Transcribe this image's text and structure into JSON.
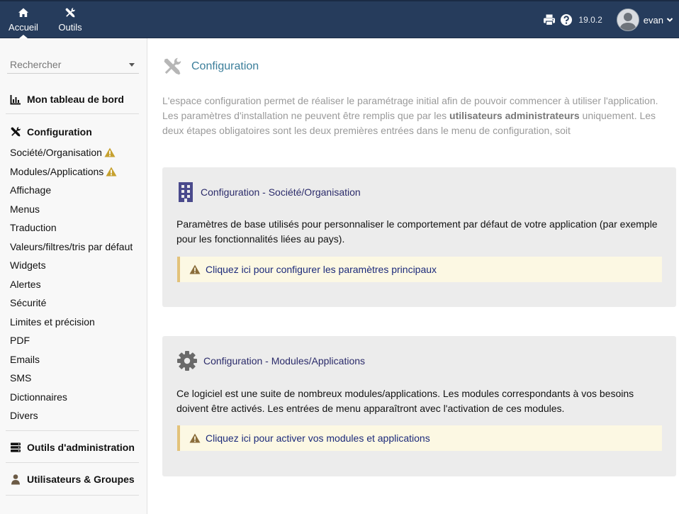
{
  "topbar": {
    "menu": [
      {
        "label": "Accueil",
        "icon": "home-icon",
        "active": true
      },
      {
        "label": "Outils",
        "icon": "tools-icon",
        "active": false
      }
    ],
    "version": "19.0.2",
    "username": "evan"
  },
  "sidebar": {
    "search_placeholder": "Rechercher",
    "dashboard_title": "Mon tableau de bord",
    "config_title": "Configuration",
    "config_items": [
      {
        "label": "Société/Organisation",
        "warning": true
      },
      {
        "label": "Modules/Applications",
        "warning": true
      },
      {
        "label": "Affichage",
        "warning": false
      },
      {
        "label": "Menus",
        "warning": false
      },
      {
        "label": "Traduction",
        "warning": false
      },
      {
        "label": "Valeurs/filtres/tris par défaut",
        "warning": false
      },
      {
        "label": "Widgets",
        "warning": false
      },
      {
        "label": "Alertes",
        "warning": false
      },
      {
        "label": "Sécurité",
        "warning": false
      },
      {
        "label": "Limites et précision",
        "warning": false
      },
      {
        "label": "PDF",
        "warning": false
      },
      {
        "label": "Emails",
        "warning": false
      },
      {
        "label": "SMS",
        "warning": false
      },
      {
        "label": "Dictionnaires",
        "warning": false
      },
      {
        "label": "Divers",
        "warning": false
      }
    ],
    "admin_tools_title": "Outils d'administration",
    "users_groups_title": "Utilisateurs & Groupes"
  },
  "main": {
    "title": "Configuration",
    "intro_part1": "L'espace configuration permet de réaliser le paramétrage initial afin de pouvoir commencer à utiliser l'application. Les paramètres d'installation ne peuvent être remplis que par les ",
    "intro_bold": "utilisateurs administrateurs",
    "intro_part2": " uniquement. Les deux étapes obligatoires sont les deux premières entrées dans le menu de configuration, soit",
    "cards": [
      {
        "title": "Configuration - Société/Organisation",
        "description": "Paramètres de base utilisés pour personnaliser le comportement par défaut de votre application (par exemple pour les fonctionnalités liées au pays).",
        "alert": "Cliquez ici pour configurer les paramètres principaux"
      },
      {
        "title": "Configuration - Modules/Applications",
        "description": "Ce logiciel est une suite de nombreux modules/applications. Les modules correspondants à vos besoins doivent être activés. Les entrées de menu apparaîtront avec l'activation de ces modules.",
        "alert": "Cliquez ici pour activer vos modules et applications"
      }
    ]
  },
  "colors": {
    "topbar": "#263c5c",
    "title_accent": "#3b7e9a",
    "card_link": "#2b2b6a",
    "warning": "#c6a12f",
    "alert_bg": "#fcf8e3"
  }
}
